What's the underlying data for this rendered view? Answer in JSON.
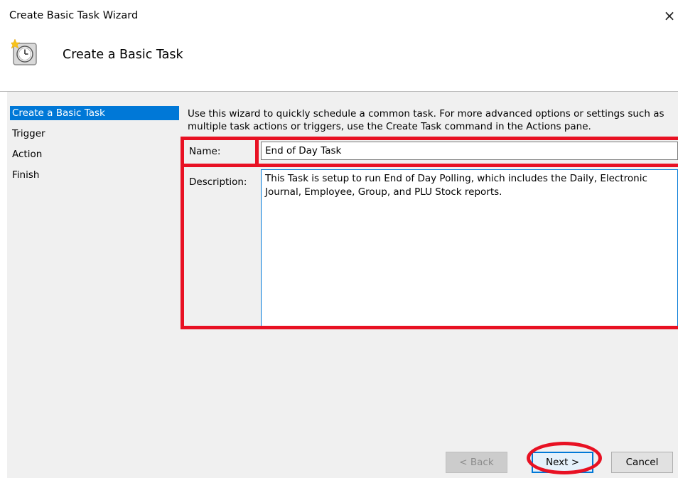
{
  "window": {
    "title": "Create Basic Task Wizard",
    "close_glyph": "×"
  },
  "header": {
    "title": "Create a Basic Task",
    "icon": "task-scheduler-clock-icon"
  },
  "nav": {
    "items": [
      {
        "label": "Create a Basic Task",
        "selected": true
      },
      {
        "label": "Trigger",
        "selected": false
      },
      {
        "label": "Action",
        "selected": false
      },
      {
        "label": "Finish",
        "selected": false
      }
    ]
  },
  "content": {
    "intro": "Use this wizard to quickly schedule a common task.  For more advanced options or settings such as multiple task actions or triggers, use the Create Task command in the Actions pane.",
    "name_label": "Name:",
    "name_value": "End of Day Task",
    "description_label": "Description:",
    "description_value": "This Task is setup to run End of Day Polling, which includes the Daily, Electronic Journal, Employee, Group, and PLU Stock reports."
  },
  "buttons": {
    "back": "< Back",
    "next": "Next >",
    "cancel": "Cancel"
  },
  "colors": {
    "selection": "#0078d7",
    "annotation": "#e81123"
  }
}
